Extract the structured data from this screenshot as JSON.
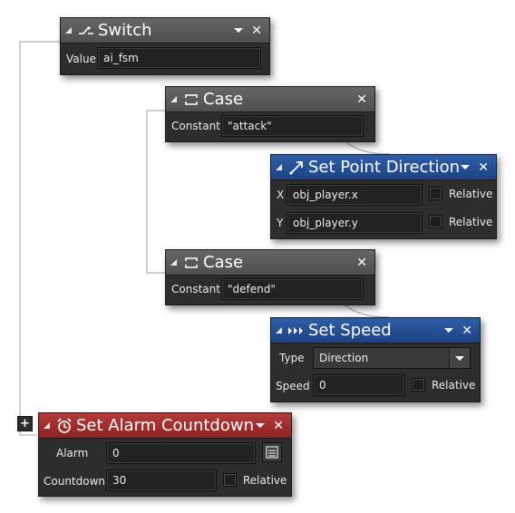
{
  "switch_block": {
    "title": "Switch",
    "icon": "switch-icon",
    "value_label": "Value",
    "value": "ai_fsm"
  },
  "case_attack": {
    "title": "Case",
    "icon": "case-icon",
    "constant_label": "Constant",
    "constant": "\"attack\""
  },
  "point_direction": {
    "title": "Set Point Direction",
    "icon": "point-direction-icon",
    "x_label": "X",
    "x_value": "obj_player.x",
    "y_label": "Y",
    "y_value": "obj_player.y",
    "relative_label": "Relative"
  },
  "case_defend": {
    "title": "Case",
    "icon": "case-icon",
    "constant_label": "Constant",
    "constant": "\"defend\""
  },
  "set_speed": {
    "title": "Set Speed",
    "icon": "speed-icon",
    "type_label": "Type",
    "type_value": "Direction",
    "speed_label": "Speed",
    "speed_value": "0",
    "relative_label": "Relative"
  },
  "alarm_block": {
    "title": "Set Alarm Countdown",
    "icon": "alarm-clock-icon",
    "alarm_label": "Alarm",
    "alarm_value": "0",
    "countdown_label": "Countdown",
    "countdown_value": "30",
    "relative_label": "Relative"
  },
  "expand_button": "+",
  "colors": {
    "gray_header": "#5a5a5a",
    "blue_header": "#244f97",
    "red_header": "#a02d2d",
    "body": "#2d2d2d"
  }
}
